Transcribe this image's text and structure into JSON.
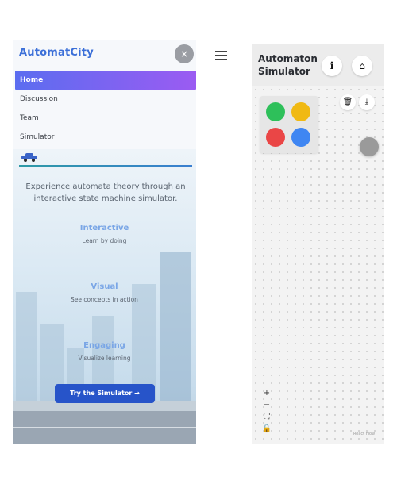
{
  "drawer": {
    "brand": "AutomatCity",
    "close_symbol": "×",
    "nav": [
      {
        "label": "Home",
        "active": true
      },
      {
        "label": "Discussion",
        "active": false
      },
      {
        "label": "Team",
        "active": false
      },
      {
        "label": "Simulator",
        "active": false
      }
    ]
  },
  "hero": {
    "tagline": "Experience automata theory through an interactive state machine simulator.",
    "features": [
      {
        "title": "Interactive",
        "subtitle": "Learn by doing"
      },
      {
        "title": "Visual",
        "subtitle": "See concepts in action"
      },
      {
        "title": "Engaging",
        "subtitle": "Visualize learning"
      }
    ],
    "cta_label": "Try the Simulator →"
  },
  "simulator": {
    "title": "Automaton Simulator",
    "info_symbol": "i",
    "home_symbol": "⌂",
    "delete_symbol": "🗑",
    "download_symbol": "⤓",
    "zoom_in": "+",
    "zoom_out": "−",
    "fit": "⛶",
    "lock": "🔒",
    "attribution": "React Flow"
  },
  "palette_colors": [
    "#2ec05a",
    "#f0b913",
    "#ea4646",
    "#3f86f2"
  ],
  "colors": {
    "brand": "#3b6fd8",
    "active_nav_start": "#5b6df0",
    "active_nav_end": "#9b5bf2",
    "cta": "#2754c9"
  }
}
